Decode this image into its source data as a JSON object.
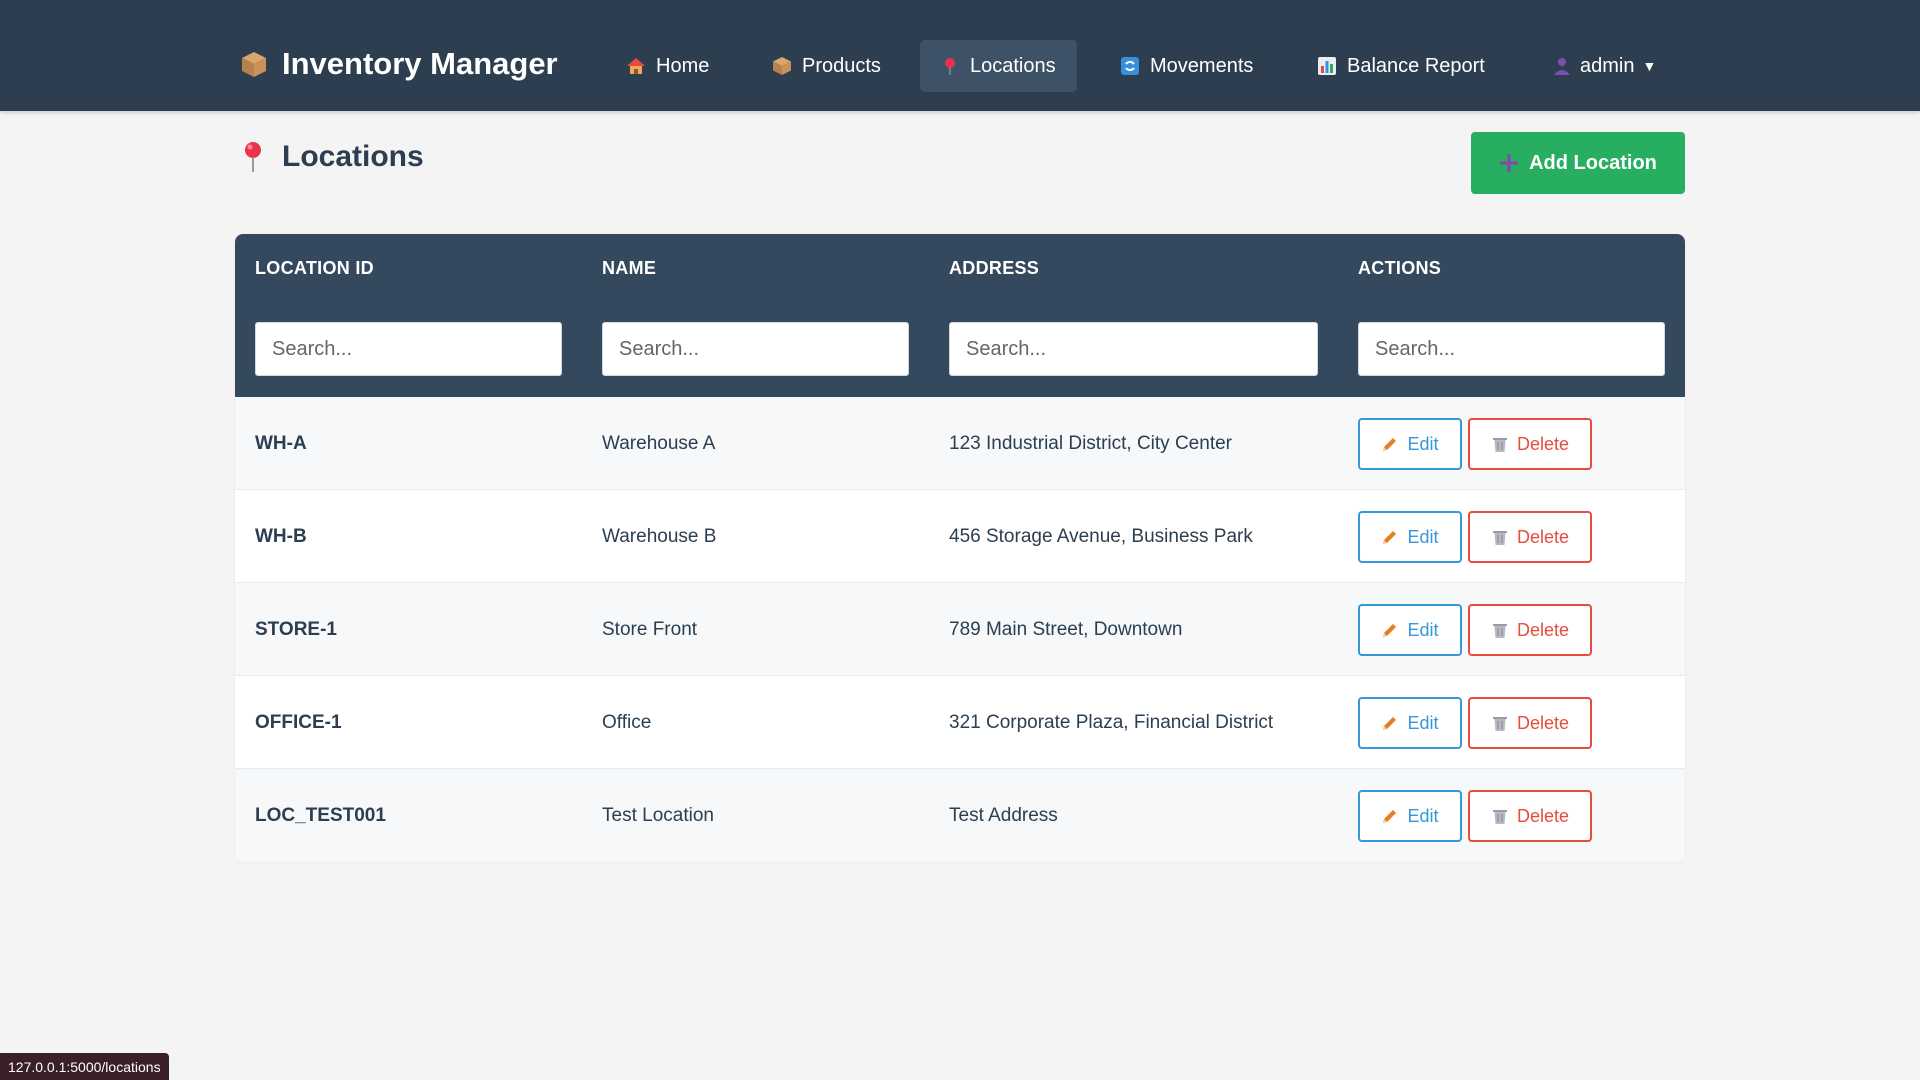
{
  "nav": {
    "brand": "Inventory Manager",
    "items": [
      {
        "label": "Home",
        "icon": "house-icon"
      },
      {
        "label": "Products",
        "icon": "box-icon"
      },
      {
        "label": "Locations",
        "icon": "pushpin-icon",
        "active": true
      },
      {
        "label": "Movements",
        "icon": "refresh-icon"
      },
      {
        "label": "Balance Report",
        "icon": "bar-chart-icon"
      }
    ],
    "user": "admin"
  },
  "page": {
    "title": "Locations",
    "add_button": "Add Location"
  },
  "table": {
    "headers": [
      "LOCATION ID",
      "NAME",
      "ADDRESS",
      "ACTIONS"
    ],
    "search_placeholder": "Search...",
    "edit_label": "Edit",
    "delete_label": "Delete",
    "rows": [
      {
        "id": "WH-A",
        "name": "Warehouse A",
        "address": "123 Industrial District, City Center"
      },
      {
        "id": "WH-B",
        "name": "Warehouse B",
        "address": "456 Storage Avenue, Business Park"
      },
      {
        "id": "STORE-1",
        "name": "Store Front",
        "address": "789 Main Street, Downtown"
      },
      {
        "id": "OFFICE-1",
        "name": "Office",
        "address": "321 Corporate Plaza, Financial District"
      },
      {
        "id": "LOC_TEST001",
        "name": "Test Location",
        "address": "Test Address"
      }
    ]
  },
  "status_bar": "127.0.0.1:5000/locations",
  "colors": {
    "navbar": "#2c3e50",
    "table_header": "#34495e",
    "add_button": "#27ae60",
    "edit": "#3498db",
    "delete": "#e74c3c"
  }
}
